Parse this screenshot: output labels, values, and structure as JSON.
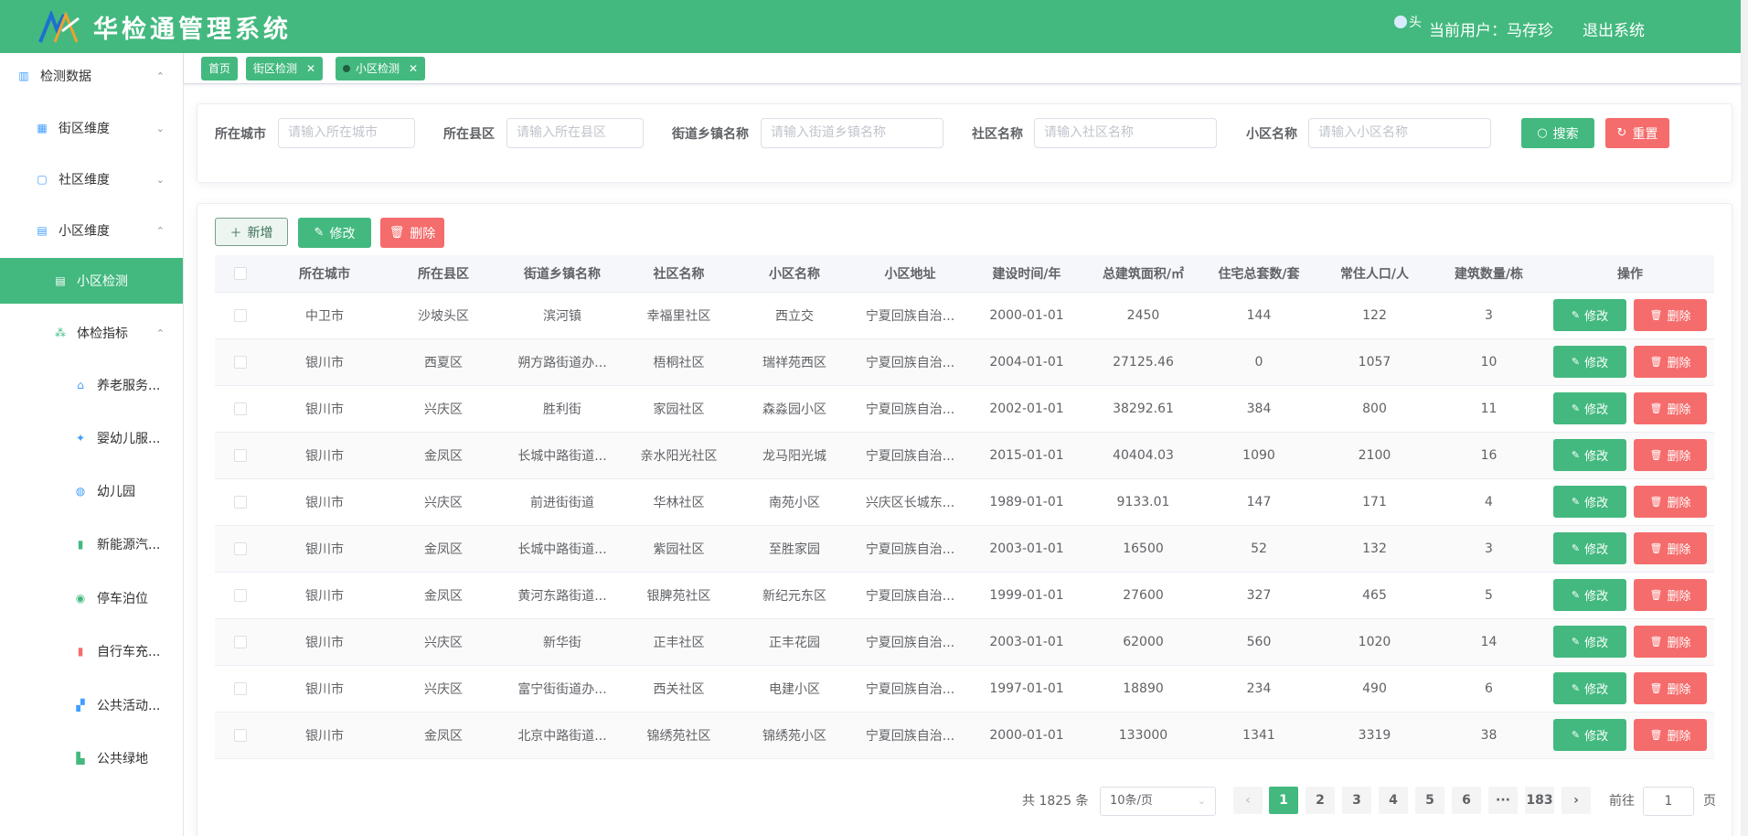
{
  "header": {
    "title": "华检通管理系统",
    "avatar_alt": "头",
    "current_user": "当前用户：马存珍",
    "logout": "退出系统"
  },
  "sidebar": [
    {
      "label": "检测数据",
      "icon": "building-data-icon",
      "arrow": "⌃",
      "active": false
    },
    {
      "label": "街区维度",
      "icon": "district-icon",
      "arrow": "⌄",
      "active": false
    },
    {
      "label": "社区维度",
      "icon": "community-icon",
      "arrow": "⌄",
      "active": false
    },
    {
      "label": "小区维度",
      "icon": "estate-icon",
      "arrow": "⌃",
      "active": false
    },
    {
      "label": "小区检测",
      "icon": "estate-check-icon",
      "arrow": "",
      "active": true
    },
    {
      "label": "体检指标",
      "icon": "chart-icon",
      "arrow": "⌃",
      "active": false
    },
    {
      "label": "养老服务...",
      "icon": "elder-icon",
      "arrow": "",
      "active": false
    },
    {
      "label": "婴幼儿服...",
      "icon": "infant-icon",
      "arrow": "",
      "active": false
    },
    {
      "label": "幼儿园",
      "icon": "kindergarten-icon",
      "arrow": "",
      "active": false
    },
    {
      "label": "新能源汽...",
      "icon": "ev-charger-icon",
      "arrow": "",
      "active": false
    },
    {
      "label": "停车泊位",
      "icon": "parking-icon",
      "arrow": "",
      "active": false
    },
    {
      "label": "自行车充...",
      "icon": "bike-charger-icon",
      "arrow": "",
      "active": false
    },
    {
      "label": "公共活动...",
      "icon": "public-activity-icon",
      "arrow": "",
      "active": false
    },
    {
      "label": "公共绿地",
      "icon": "green-space-icon",
      "arrow": "",
      "active": false
    }
  ],
  "tags": [
    {
      "label": "首页",
      "closable": false,
      "current": false
    },
    {
      "label": "街区检测",
      "closable": true,
      "current": false
    },
    {
      "label": "小区检测",
      "closable": true,
      "current": true
    }
  ],
  "search": {
    "city_label": "所在城市",
    "city_placeholder": "请输入所在城市",
    "county_label": "所在县区",
    "county_placeholder": "请输入所在县区",
    "street_label": "街道乡镇名称",
    "street_placeholder": "请输入街道乡镇名称",
    "community_label": "社区名称",
    "community_placeholder": "请输入社区名称",
    "estate_label": "小区名称",
    "estate_placeholder": "请输入小区名称",
    "search_btn": "搜索",
    "reset_btn": "重置"
  },
  "toolbar": {
    "add": "新增",
    "edit": "修改",
    "delete": "删除"
  },
  "table": {
    "headers": [
      "所在城市",
      "所在县区",
      "街道乡镇名称",
      "社区名称",
      "小区名称",
      "小区地址",
      "建设时间/年",
      "总建筑面积/㎡",
      "住宅总套数/套",
      "常住人口/人",
      "建筑数量/栋",
      "操作"
    ],
    "rows": [
      [
        "中卫市",
        "沙坡头区",
        "滨河镇",
        "幸福里社区",
        "西立交",
        "宁夏回族自治...",
        "2000-01-01",
        "2450",
        "144",
        "122",
        "3"
      ],
      [
        "银川市",
        "西夏区",
        "朔方路街道办...",
        "梧桐社区",
        "瑞祥苑西区",
        "宁夏回族自治...",
        "2004-01-01",
        "27125.46",
        "0",
        "1057",
        "10"
      ],
      [
        "银川市",
        "兴庆区",
        "胜利街",
        "家园社区",
        "森淼园小区",
        "宁夏回族自治...",
        "2002-01-01",
        "38292.61",
        "384",
        "800",
        "11"
      ],
      [
        "银川市",
        "金凤区",
        "长城中路街道...",
        "亲水阳光社区",
        "龙马阳光城",
        "宁夏回族自治...",
        "2015-01-01",
        "40404.03",
        "1090",
        "2100",
        "16"
      ],
      [
        "银川市",
        "兴庆区",
        "前进街街道",
        "华林社区",
        "南苑小区",
        "兴庆区长城东...",
        "1989-01-01",
        "9133.01",
        "147",
        "171",
        "4"
      ],
      [
        "银川市",
        "金凤区",
        "长城中路街道...",
        "紫园社区",
        "至胜家园",
        "宁夏回族自治...",
        "2003-01-01",
        "16500",
        "52",
        "132",
        "3"
      ],
      [
        "银川市",
        "金凤区",
        "黄河东路街道...",
        "银脾苑社区",
        "新纪元东区",
        "宁夏回族自治...",
        "1999-01-01",
        "27600",
        "327",
        "465",
        "5"
      ],
      [
        "银川市",
        "兴庆区",
        "新华街",
        "正丰社区",
        "正丰花园",
        "宁夏回族自治...",
        "2003-01-01",
        "62000",
        "560",
        "1020",
        "14"
      ],
      [
        "银川市",
        "兴庆区",
        "富宁街街道办...",
        "西关社区",
        "电建小区",
        "宁夏回族自治...",
        "1997-01-01",
        "18890",
        "234",
        "490",
        "6"
      ],
      [
        "银川市",
        "金凤区",
        "北京中路街道...",
        "锦绣苑社区",
        "锦绣苑小区",
        "宁夏回族自治...",
        "2000-01-01",
        "133000",
        "1341",
        "3319",
        "38"
      ]
    ],
    "row_edit": "修改",
    "row_delete": "删除"
  },
  "pager": {
    "total": "共 1825 条",
    "page_size": "10条/页",
    "prev": "‹",
    "pages": [
      "1",
      "2",
      "3",
      "4",
      "5",
      "6",
      "···",
      "183"
    ],
    "next": "›",
    "goto_label": "前往",
    "goto_value": "1",
    "page_unit": "页",
    "active_page": "1"
  },
  "colors": {
    "accent": "#43b97f",
    "danger": "#f56c6c"
  }
}
